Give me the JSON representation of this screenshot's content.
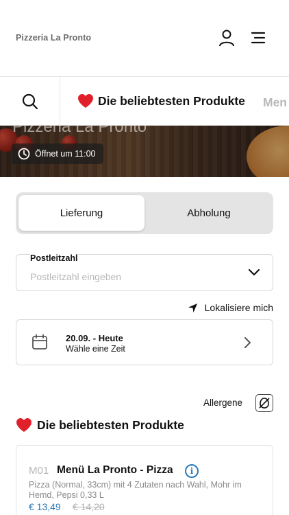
{
  "header": {
    "brand": "Pizzeria La Pronto",
    "icons": [
      "user-icon",
      "menu-icon"
    ]
  },
  "category_bar": {
    "search_icon": "search-icon",
    "active_label": "Die beliebtesten Produkte",
    "next_label": "Men"
  },
  "hero": {
    "title": "Pizzeria La Pronto",
    "opening": "Öffnet um 11:00"
  },
  "delivery_toggle": {
    "delivery_label": "Lieferung",
    "pickup_label": "Abholung",
    "selected": "Lieferung"
  },
  "postcode": {
    "label": "Postleitzahl",
    "placeholder": "Postleitzahl eingeben",
    "value": ""
  },
  "locate": {
    "label": "Lokalisiere mich"
  },
  "date_select": {
    "date": "20.09. - Heute",
    "hint": "Wähle eine Zeit"
  },
  "allergens": {
    "label": "Allergene"
  },
  "section": {
    "title": "Die beliebtesten Produkte"
  },
  "products": [
    {
      "code": "M01",
      "name": "Menü La Pronto - Pizza",
      "description": "Pizza (Normal, 33cm) mit 4 Zutaten nach Wahl, Mohr im Hemd, Pepsi 0,33 L",
      "price": "€ 13,49",
      "old_price": "€ 14,20"
    }
  ],
  "colors": {
    "accent_blue": "#2a7ab8",
    "heart_red": "#e0202a",
    "muted_text": "#8a8a8a",
    "toggle_bg": "#e4e4e4"
  }
}
